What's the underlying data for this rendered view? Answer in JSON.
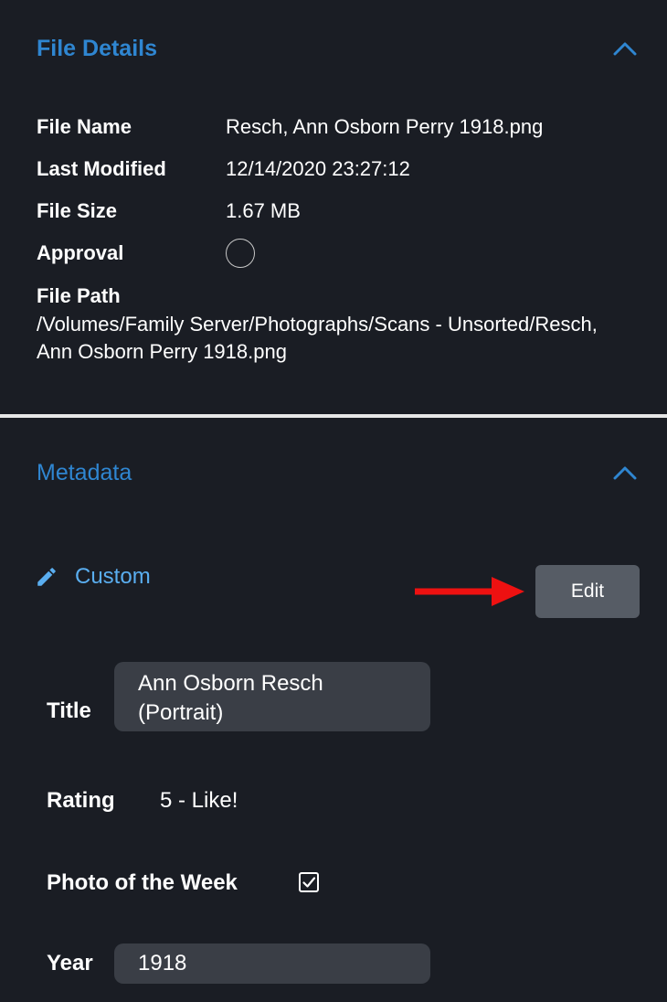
{
  "file_details": {
    "title": "File Details",
    "rows": [
      {
        "label": "File Name",
        "value": "Resch, Ann Osborn Perry 1918.png"
      },
      {
        "label": "Last Modified",
        "value": "12/14/2020 23:27:12"
      },
      {
        "label": "File Size",
        "value": "1.67 MB"
      },
      {
        "label": "Approval",
        "value": ""
      }
    ],
    "file_path_label": "File Path",
    "file_path_value": "/Volumes/Family Server/Photographs/Scans - Unsorted/Resch, Ann Osborn Perry 1918.png"
  },
  "metadata": {
    "title": "Metadata",
    "template_label": "Custom",
    "edit_label": "Edit",
    "fields": {
      "title_label": "Title",
      "title_value": "Ann Osborn Resch (Portrait)",
      "rating_label": "Rating",
      "rating_value": "5 - Like!",
      "photo_week_label": "Photo of the Week",
      "photo_week_checked": true,
      "year_label": "Year",
      "year_value": "1918"
    }
  },
  "colors": {
    "background": "#1a1d24",
    "section_title": "#2f86d1",
    "custom_link": "#5aaef0",
    "edit_button": "#565c65",
    "field_box": "#3a3e46",
    "annotation_arrow": "#ee1111"
  },
  "icons": {
    "collapse": "chevron-up-icon",
    "custom": "pencil-icon",
    "approval": "circle-outline-icon",
    "photo_week": "checkbox-checked-icon"
  }
}
